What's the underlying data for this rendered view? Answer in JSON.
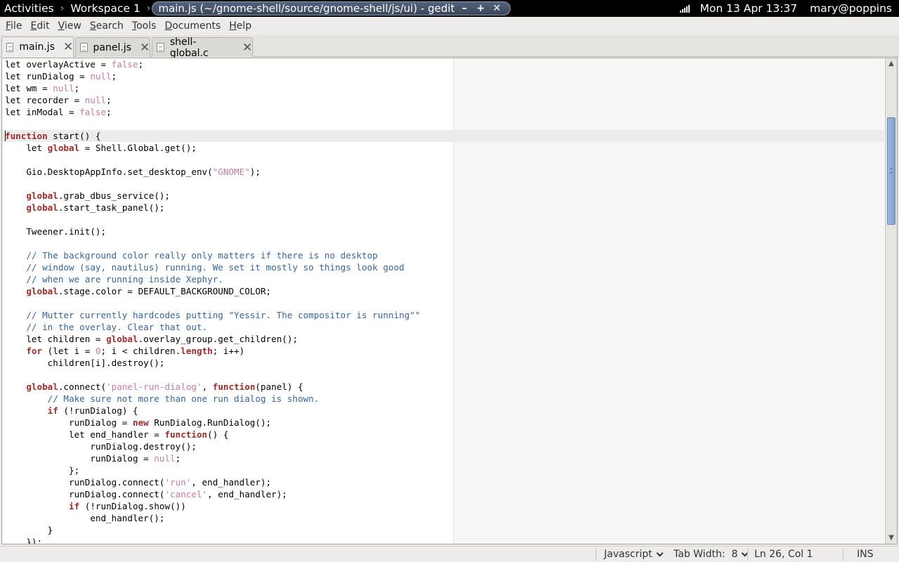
{
  "top_panel": {
    "activities": "Activities",
    "separator": "›",
    "workspace": "Workspace 1",
    "window_title": "main.js (~/gnome-shell/source/gnome-shell/js/ui) - gedit",
    "minimize": "–",
    "maximize": "+",
    "close": "✕",
    "clock": "Mon 13 Apr 13:37",
    "user": "mary@poppins",
    "icon": "signal-icon"
  },
  "menubar": [
    "File",
    "Edit",
    "View",
    "Search",
    "Tools",
    "Documents",
    "Help"
  ],
  "tabs": [
    {
      "label": "main.js",
      "active": true
    },
    {
      "label": "panel.js",
      "active": false
    },
    {
      "label": "shell-global.c",
      "active": false
    }
  ],
  "code_lines": [
    [
      {
        "t": "let overlayActive = "
      },
      {
        "t": "false",
        "c": "nu"
      },
      {
        "t": ";"
      }
    ],
    [
      {
        "t": "let runDialog = "
      },
      {
        "t": "null",
        "c": "nu"
      },
      {
        "t": ";"
      }
    ],
    [
      {
        "t": "let wm = "
      },
      {
        "t": "null",
        "c": "nu"
      },
      {
        "t": ";"
      }
    ],
    [
      {
        "t": "let recorder = "
      },
      {
        "t": "null",
        "c": "nu"
      },
      {
        "t": ";"
      }
    ],
    [
      {
        "t": "let inModal = "
      },
      {
        "t": "false",
        "c": "nu"
      },
      {
        "t": ";"
      }
    ],
    [],
    [
      {
        "t": "function",
        "c": "kw"
      },
      {
        "t": " start() {"
      }
    ],
    [
      {
        "t": "    let "
      },
      {
        "t": "global",
        "c": "kw"
      },
      {
        "t": " = Shell.Global.get();"
      }
    ],
    [],
    [
      {
        "t": "    Gio.DesktopAppInfo.set_desktop_env("
      },
      {
        "t": "\"GNOME\"",
        "c": "st"
      },
      {
        "t": ");"
      }
    ],
    [],
    [
      {
        "t": "    "
      },
      {
        "t": "global",
        "c": "kw"
      },
      {
        "t": ".grab_dbus_service();"
      }
    ],
    [
      {
        "t": "    "
      },
      {
        "t": "global",
        "c": "kw"
      },
      {
        "t": ".start_task_panel();"
      }
    ],
    [],
    [
      {
        "t": "    Tweener.init();"
      }
    ],
    [],
    [
      {
        "t": "    // The background color really only matters if there is no desktop",
        "c": "cm"
      }
    ],
    [
      {
        "t": "    // window (say, nautilus) running. We set it mostly so things look good",
        "c": "cm"
      }
    ],
    [
      {
        "t": "    // when we are running inside Xephyr.",
        "c": "cm"
      }
    ],
    [
      {
        "t": "    "
      },
      {
        "t": "global",
        "c": "kw"
      },
      {
        "t": ".stage.color = DEFAULT_BACKGROUND_COLOR;"
      }
    ],
    [],
    [
      {
        "t": "    // Mutter currently hardcodes putting \"Yessir. The compositor is running\"\"",
        "c": "cm"
      }
    ],
    [
      {
        "t": "    // in the overlay. Clear that out.",
        "c": "cm"
      }
    ],
    [
      {
        "t": "    let children = "
      },
      {
        "t": "global",
        "c": "kw"
      },
      {
        "t": ".overlay_group.get_children();"
      }
    ],
    [
      {
        "t": "    "
      },
      {
        "t": "for",
        "c": "kw"
      },
      {
        "t": " (let i = "
      },
      {
        "t": "0",
        "c": "nu"
      },
      {
        "t": "; i < children."
      },
      {
        "t": "length",
        "c": "kw"
      },
      {
        "t": "; i++)"
      }
    ],
    [
      {
        "t": "        children[i].destroy();"
      }
    ],
    [],
    [
      {
        "t": "    "
      },
      {
        "t": "global",
        "c": "kw"
      },
      {
        "t": ".connect("
      },
      {
        "t": "'panel-run-dialog'",
        "c": "st"
      },
      {
        "t": ", "
      },
      {
        "t": "function",
        "c": "kw"
      },
      {
        "t": "(panel) {"
      }
    ],
    [
      {
        "t": "        // Make sure not more than one run dialog is shown.",
        "c": "cm"
      }
    ],
    [
      {
        "t": "        "
      },
      {
        "t": "if",
        "c": "kw"
      },
      {
        "t": " (!runDialog) {"
      }
    ],
    [
      {
        "t": "            runDialog = "
      },
      {
        "t": "new",
        "c": "kw"
      },
      {
        "t": " RunDialog.RunDialog();"
      }
    ],
    [
      {
        "t": "            let end_handler = "
      },
      {
        "t": "function",
        "c": "kw"
      },
      {
        "t": "() {"
      }
    ],
    [
      {
        "t": "                runDialog.destroy();"
      }
    ],
    [
      {
        "t": "                runDialog = "
      },
      {
        "t": "null",
        "c": "nu"
      },
      {
        "t": ";"
      }
    ],
    [
      {
        "t": "            };"
      }
    ],
    [
      {
        "t": "            runDialog.connect("
      },
      {
        "t": "'run'",
        "c": "st"
      },
      {
        "t": ", end_handler);"
      }
    ],
    [
      {
        "t": "            runDialog.connect("
      },
      {
        "t": "'cancel'",
        "c": "st"
      },
      {
        "t": ", end_handler);"
      }
    ],
    [
      {
        "t": "            "
      },
      {
        "t": "if",
        "c": "kw"
      },
      {
        "t": " (!runDialog.show())"
      }
    ],
    [
      {
        "t": "                end_handler();"
      }
    ],
    [
      {
        "t": "        }"
      }
    ],
    [
      {
        "t": "    });"
      }
    ]
  ],
  "current_line_index": 6,
  "statusbar": {
    "language": "Javascript",
    "tab_width": "Tab Width:  8",
    "position": "Ln 26, Col 1",
    "mode": "INS"
  }
}
